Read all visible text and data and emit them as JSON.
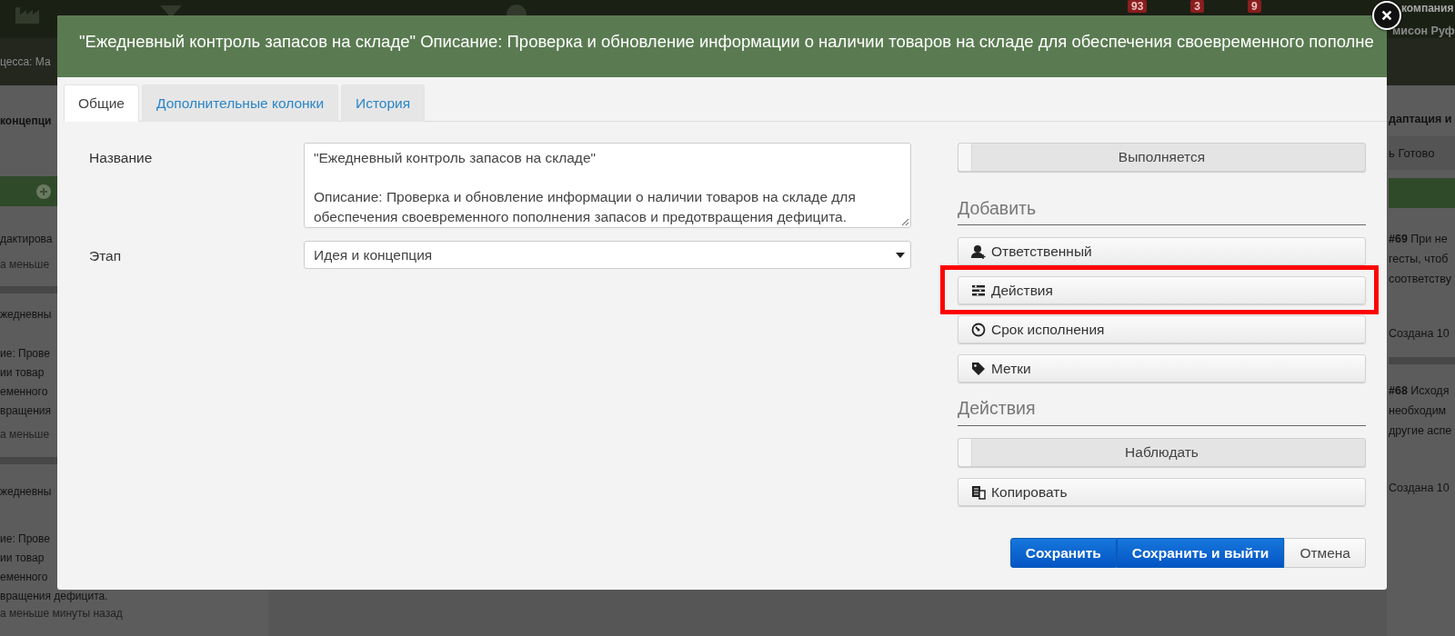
{
  "top_bar": {
    "badges": [
      {
        "count": "93"
      },
      {
        "count": "3"
      },
      {
        "count": "9"
      }
    ],
    "account": {
      "company": "компания",
      "user": "мисон Руф"
    }
  },
  "sub_bar": {
    "text": "цесса: Ма"
  },
  "left_column": {
    "header": "концепци",
    "cards": [
      {
        "title": "дактирова",
        "time": "а меньше"
      },
      {
        "title": "жедневны",
        "lines": [
          "ие: Прове",
          "ии товар",
          "еменного",
          "вращения"
        ],
        "time": "а меньше"
      },
      {
        "title": "жедневны",
        "lines": [
          "ие: Прове",
          "ии товар",
          "еменного",
          "вращения дефицита."
        ],
        "time": "а меньше минуты назад"
      }
    ]
  },
  "right_column": {
    "header": "даптация и",
    "status": "ь Готово",
    "cards": [
      {
        "title": "**#69** При не",
        "lines": [
          "гесты, чтоб",
          "соответству"
        ],
        "created": "Создана 10"
      },
      {
        "title": "**#68** Исходя",
        "lines": [
          "необходим",
          "другие аспе"
        ],
        "created": "Создана 10"
      }
    ]
  },
  "modal": {
    "title": "\"Ежедневный контроль запасов на складе\" Описание: Проверка и обновление информации о наличии товаров на складе для обеспечения своевременного пополне",
    "tabs": [
      {
        "label": "Общие",
        "selected": true
      },
      {
        "label": "Дополнительные колонки",
        "selected": false
      },
      {
        "label": "История",
        "selected": false
      }
    ],
    "fields": [
      {
        "label": "Название",
        "kind": "textarea",
        "value": "\"Ежедневный контроль запасов на складе\"\n\nОписание: Проверка и обновление информации о наличии товаров на складе для обеспечения своевременного пополнения запасов и предотвращения дефицита."
      },
      {
        "label": "Этап",
        "kind": "select",
        "value": "Идея и концепция"
      }
    ],
    "status_toggle": {
      "label": "Выполняется",
      "on": false
    },
    "sections": [
      {
        "heading": "Добавить",
        "buttons": [
          {
            "kind": "button",
            "label": "Ответственный",
            "highlighted": false
          },
          {
            "kind": "button",
            "label": "Действия",
            "highlighted": true
          },
          {
            "kind": "button",
            "label": "Срок исполнения",
            "highlighted": false
          },
          {
            "kind": "button",
            "label": "Метки",
            "highlighted": false
          }
        ]
      },
      {
        "heading": "Действия",
        "buttons": [
          {
            "kind": "toggle",
            "label": "Наблюдать",
            "on": false,
            "highlighted": false
          },
          {
            "kind": "button",
            "label": "Копировать",
            "highlighted": false
          }
        ]
      }
    ],
    "footer_buttons": [
      {
        "label": "Сохранить",
        "kind": "primary"
      },
      {
        "label": "Сохранить и выйти",
        "kind": "primary"
      },
      {
        "label": "Отмена",
        "kind": "default"
      }
    ]
  }
}
